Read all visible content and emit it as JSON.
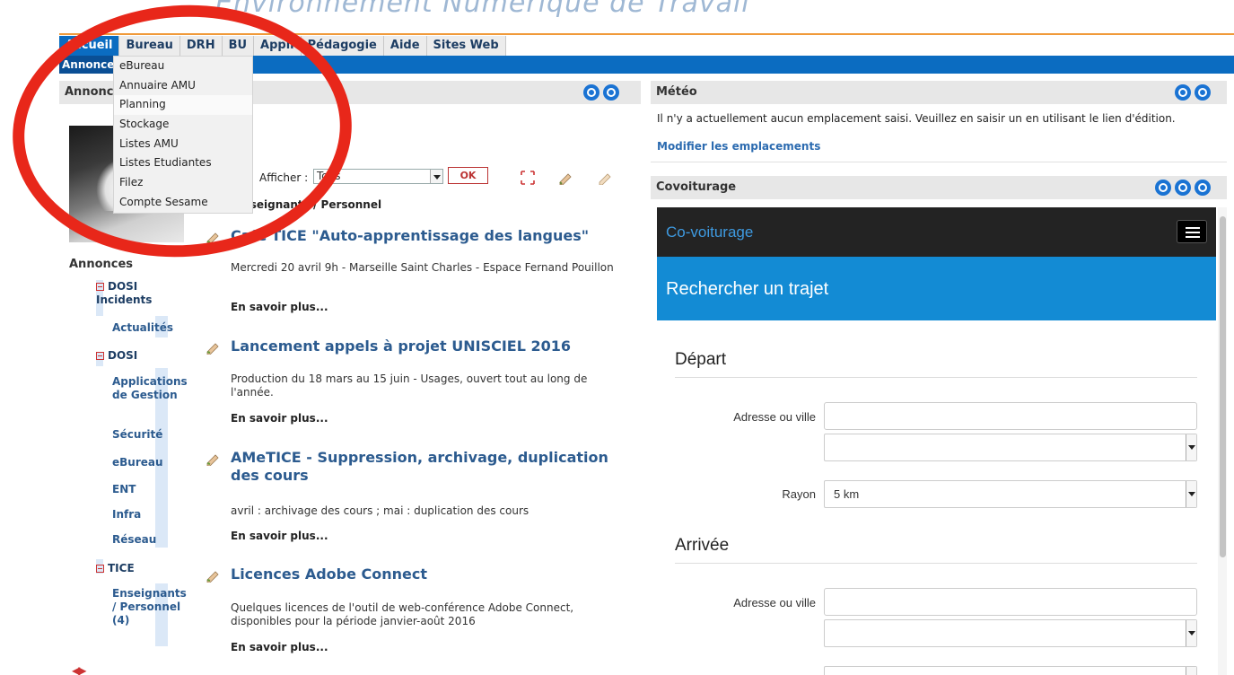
{
  "app_title": "Environnement Numérique de Travail",
  "tabs": [
    {
      "label": "Accueil",
      "active": true
    },
    {
      "label": "Bureau"
    },
    {
      "label": "DRH"
    },
    {
      "label": "BU"
    },
    {
      "label": "Appli"
    },
    {
      "label": "Pédagogie"
    },
    {
      "label": "Aide"
    },
    {
      "label": "Sites Web"
    }
  ],
  "subtab_active": "Annonces",
  "dropdown": [
    "eBureau",
    "Annuaire AMU",
    "Planning",
    "Stockage",
    "Listes AMU",
    "Listes Etudiantes",
    "Filez",
    "Compte Sesame"
  ],
  "annonces_panel": {
    "title": "Annonces"
  },
  "filter": {
    "label": "Afficher :",
    "value": "Tous",
    "ok": "OK"
  },
  "crumb": "Enseignants / Personnel",
  "tree": {
    "heading": "Annonces",
    "cat1": "DOSI Incidents",
    "cat1_items": [
      "Actualités"
    ],
    "cat2": "DOSI",
    "cat2_items": [
      "Applications de Gestion",
      "Sécurité",
      "eBureau",
      "ENT",
      "Infra",
      "Réseau"
    ],
    "cat3": "TICE",
    "cat3_items": [
      "Enseignants / Personnel (4)"
    ]
  },
  "news": [
    {
      "title": "Café'TICE \"Auto-apprentissage des langues\"",
      "desc": "Mercredi 20 avril 9h - Marseille Saint Charles - Espace Fernand Pouillon",
      "more": "En savoir plus..."
    },
    {
      "title": "Lancement appels à projet UNISCIEL 2016",
      "desc": "Production du 18 mars au 15 juin - Usages, ouvert tout au long de l'année.",
      "more": "En savoir plus..."
    },
    {
      "title": "AMeTICE - Suppression, archivage, duplication des cours",
      "desc": "avril : archivage des cours ; mai : duplication des cours",
      "more": "En savoir plus..."
    },
    {
      "title": "Licences Adobe Connect",
      "desc": "Quelques licences de l'outil de web-conférence Adobe Connect, disponibles pour la période janvier-août 2016",
      "more": "En savoir plus..."
    }
  ],
  "meteo": {
    "title": "Météo",
    "message": "Il n'y a actuellement aucun emplacement saisi. Veuillez en saisir un en utilisant le lien d'édition.",
    "link": "Modifier les emplacements"
  },
  "covoit": {
    "panel_title": "Covoiturage",
    "brand": "Co-voiturage",
    "hero": "Rechercher un trajet",
    "depart": "Départ",
    "arrivee": "Arrivée",
    "address_label": "Adresse ou ville",
    "rayon_label": "Rayon",
    "rayon_value": "5 km"
  },
  "colors": {
    "accent_blue": "#0b6cc1",
    "link": "#2c5b8f",
    "orange": "#f09a3a",
    "annotation_red": "#e8271a"
  }
}
